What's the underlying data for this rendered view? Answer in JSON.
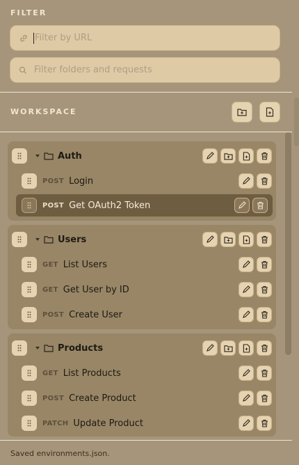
{
  "filter": {
    "title": "FILTER",
    "url_placeholder": "Filter by URL",
    "folders_placeholder": "Filter folders and requests"
  },
  "workspace": {
    "title": "WORKSPACE",
    "buttons": [
      "new-folder",
      "new-request"
    ]
  },
  "folders": [
    {
      "name": "Auth",
      "requests": [
        {
          "method": "POST",
          "label": "Login",
          "selected": false
        },
        {
          "method": "POST",
          "label": "Get OAuth2 Token",
          "selected": true
        }
      ]
    },
    {
      "name": "Users",
      "requests": [
        {
          "method": "GET",
          "label": "List Users"
        },
        {
          "method": "GET",
          "label": "Get User by ID"
        },
        {
          "method": "POST",
          "label": "Create User"
        }
      ]
    },
    {
      "name": "Products",
      "requests": [
        {
          "method": "GET",
          "label": "List Products"
        },
        {
          "method": "POST",
          "label": "Create Product"
        },
        {
          "method": "PATCH",
          "label": "Update Product"
        }
      ]
    }
  ],
  "status": "Saved environments.json.",
  "colors": {
    "background": "#a6957a",
    "folder_bg": "#988667",
    "selected_row": "#6f5d42",
    "input_bg": "#dfcaa6",
    "button_bg": "#e6d3b1"
  }
}
